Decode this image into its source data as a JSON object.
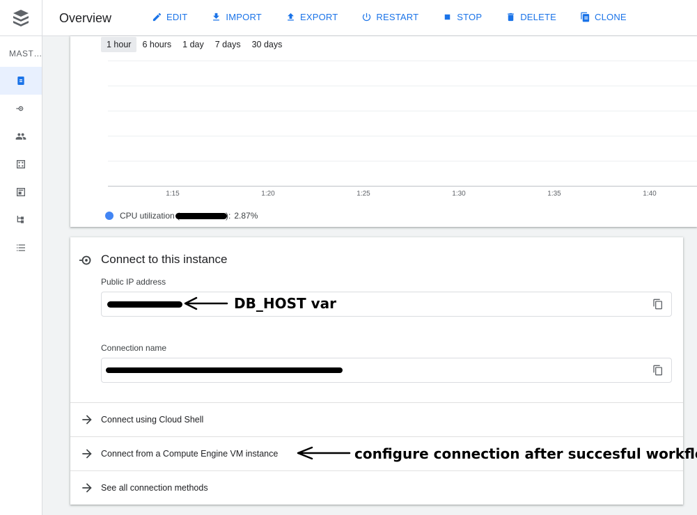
{
  "header": {
    "title": "Overview",
    "actions": [
      {
        "label": "EDIT",
        "icon": "pencil-icon"
      },
      {
        "label": "IMPORT",
        "icon": "import-icon"
      },
      {
        "label": "EXPORT",
        "icon": "export-icon"
      },
      {
        "label": "RESTART",
        "icon": "power-icon"
      },
      {
        "label": "STOP",
        "icon": "stop-icon"
      },
      {
        "label": "DELETE",
        "icon": "trash-icon"
      },
      {
        "label": "CLONE",
        "icon": "clone-icon"
      }
    ]
  },
  "sidebar": {
    "heading": "MAST…",
    "items": [
      {
        "icon": "overview-icon",
        "active": true
      },
      {
        "icon": "connections-icon",
        "active": false
      },
      {
        "icon": "users-icon",
        "active": false
      },
      {
        "icon": "databases-icon",
        "active": false
      },
      {
        "icon": "backups-icon",
        "active": false
      },
      {
        "icon": "replicas-icon",
        "active": false
      },
      {
        "icon": "operations-icon",
        "active": false
      }
    ]
  },
  "chart": {
    "ranges": [
      "1 hour",
      "6 hours",
      "1 day",
      "7 days",
      "30 days"
    ],
    "selected_range": "1 hour",
    "x_ticks": [
      "1:15",
      "1:20",
      "1:25",
      "1:30",
      "1:35",
      "1:40"
    ],
    "legend_label": "CPU utilization (",
    "legend_suffix": "):",
    "legend_value": "2.87%"
  },
  "chart_data": {
    "type": "line",
    "x": [
      "1:15",
      "1:20",
      "1:25",
      "1:30",
      "1:35",
      "1:40"
    ],
    "series": [
      {
        "name": "CPU utilization",
        "values": []
      }
    ],
    "legend_value": "2.87%",
    "grid": true
  },
  "connect": {
    "title": "Connect to this instance",
    "public_ip_label": "Public IP address",
    "connection_name_label": "Connection name",
    "rows": [
      "Connect using Cloud Shell",
      "Connect from a Compute Engine VM instance",
      "See all connection methods"
    ]
  },
  "annotations": {
    "db_host": "DB_HOST var",
    "workflow": "configure connection after succesful workflow"
  },
  "colors": {
    "accent": "#1a73e8",
    "active_bg": "#e8f0fe",
    "legend_dot": "#4285f4"
  }
}
